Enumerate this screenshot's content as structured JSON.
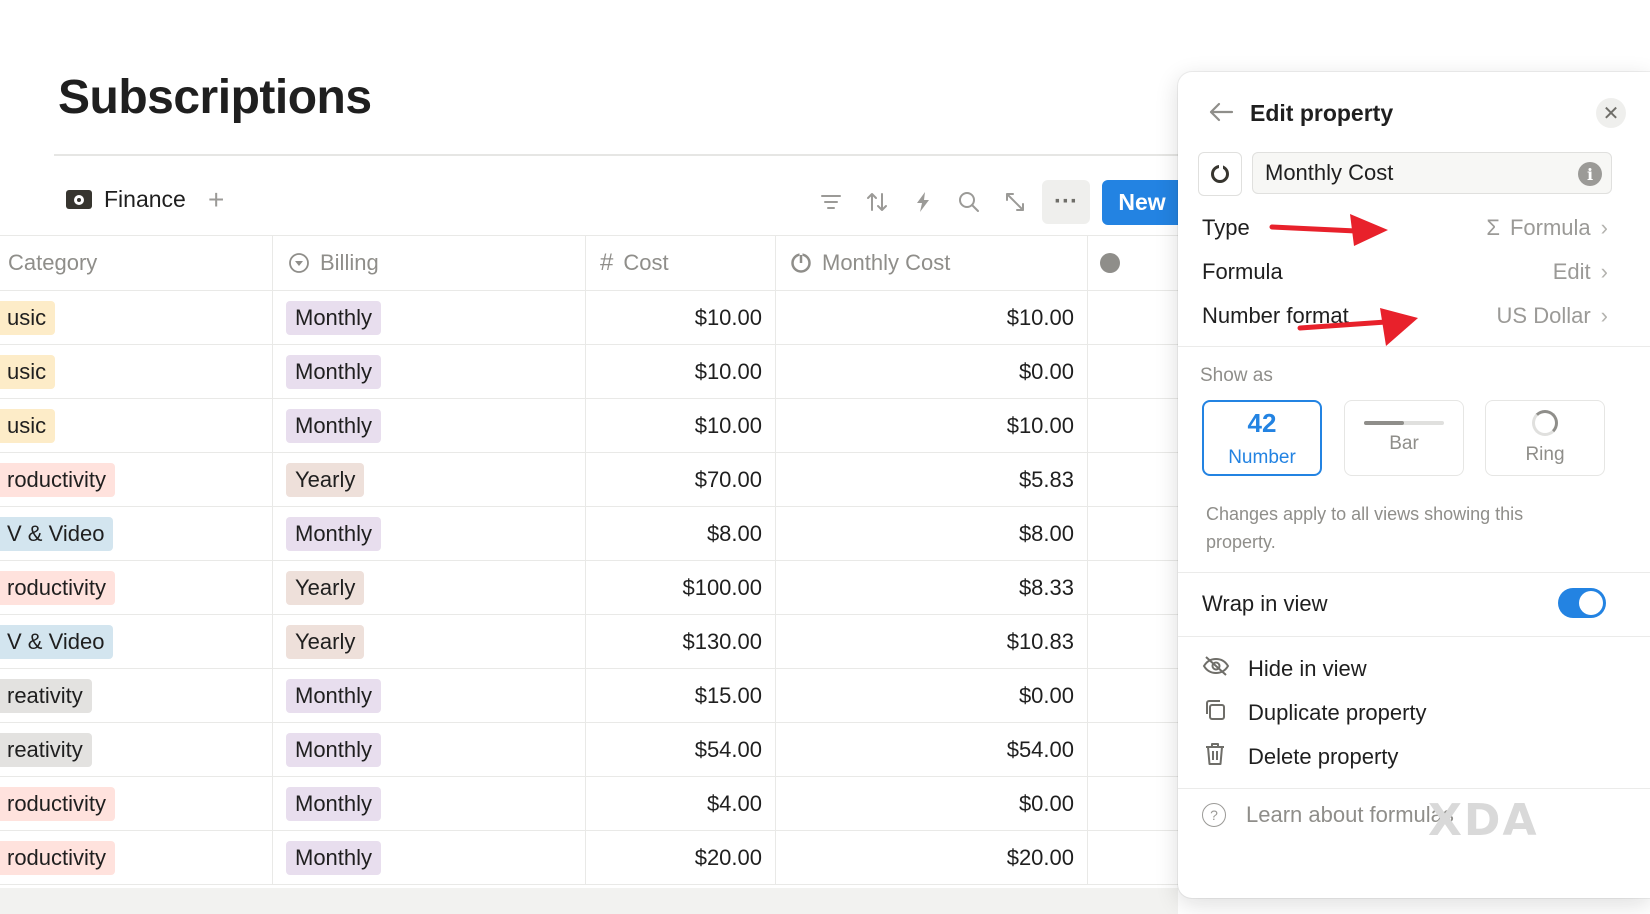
{
  "page": {
    "title": "Subscriptions"
  },
  "view": {
    "tab_label": "Finance",
    "add_label": "+"
  },
  "toolbar": {
    "filter_icon": "filter-icon",
    "sort_icon": "sort-icon",
    "automation_icon": "lightning-icon",
    "search_icon": "search-icon",
    "expand_icon": "expand-icon",
    "more_label": "···",
    "new_label": "New"
  },
  "table": {
    "headers": {
      "category": "Category",
      "billing": "Billing",
      "cost": "Cost",
      "monthly_cost": "Monthly Cost"
    },
    "header_icons": {
      "billing": "select-icon",
      "cost_symbol": "#",
      "monthly_cost": "formula-ring-icon"
    },
    "rows": [
      {
        "category": "usic",
        "billing": "Monthly",
        "cost": "$10.00",
        "monthly_cost": "$10.00"
      },
      {
        "category": "usic",
        "billing": "Monthly",
        "cost": "$10.00",
        "monthly_cost": "$0.00"
      },
      {
        "category": "usic",
        "billing": "Monthly",
        "cost": "$10.00",
        "monthly_cost": "$10.00"
      },
      {
        "category": "roductivity",
        "billing": "Yearly",
        "cost": "$70.00",
        "monthly_cost": "$5.83"
      },
      {
        "category": "V & Video",
        "billing": "Monthly",
        "cost": "$8.00",
        "monthly_cost": "$8.00"
      },
      {
        "category": "roductivity",
        "billing": "Yearly",
        "cost": "$100.00",
        "monthly_cost": "$8.33"
      },
      {
        "category": "V & Video",
        "billing": "Yearly",
        "cost": "$130.00",
        "monthly_cost": "$10.83"
      },
      {
        "category": "reativity",
        "billing": "Monthly",
        "cost": "$15.00",
        "monthly_cost": "$0.00"
      },
      {
        "category": "reativity",
        "billing": "Monthly",
        "cost": "$54.00",
        "monthly_cost": "$54.00"
      },
      {
        "category": "roductivity",
        "billing": "Monthly",
        "cost": "$4.00",
        "monthly_cost": "$0.00"
      },
      {
        "category": "roductivity",
        "billing": "Monthly",
        "cost": "$20.00",
        "monthly_cost": "$20.00"
      }
    ]
  },
  "tag_colors": {
    "usic": "#fdecc8",
    "roductivity": "#ffe2dd",
    "V & Video": "#d3e5ef",
    "reativity": "#e3e2e0",
    "Monthly": "#e8deee",
    "Yearly": "#eee0da"
  },
  "panel": {
    "title": "Edit property",
    "property_name": "Monthly Cost",
    "type_label": "Type",
    "type_value": "Formula",
    "type_symbol": "Σ",
    "formula_label": "Formula",
    "formula_value": "Edit",
    "format_label": "Number format",
    "format_value": "US Dollar",
    "show_as_label": "Show as",
    "options": {
      "number_big": "42",
      "number_label": "Number",
      "bar_label": "Bar",
      "ring_label": "Ring"
    },
    "bar_fill_fraction": 0.5,
    "hint": "Changes apply to all views showing this property.",
    "wrap_label": "Wrap in view",
    "wrap_on": true,
    "hide_label": "Hide in view",
    "duplicate_label": "Duplicate property",
    "delete_label": "Delete property",
    "learn_label": "Learn about formulas"
  },
  "colors": {
    "accent": "#2383e2",
    "arrow": "#e8212b"
  },
  "watermark": "XDA"
}
